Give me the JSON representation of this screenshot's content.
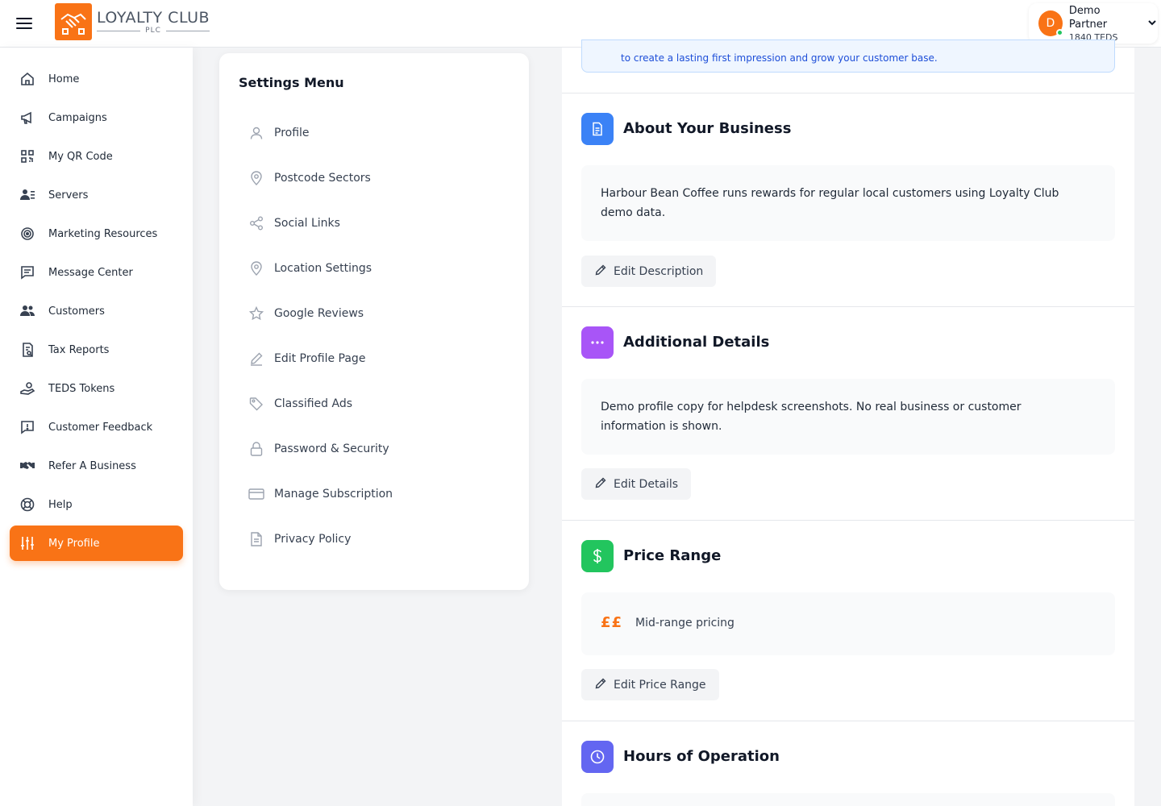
{
  "header": {
    "logo_title": "LOYALTY CLUB",
    "logo_subtitle": "PLC",
    "user_initial": "D",
    "user_name": "Demo Partner",
    "user_tokens": "1840 TEDS"
  },
  "sidebar": {
    "items": [
      {
        "label": "Home",
        "icon": "home-icon"
      },
      {
        "label": "Campaigns",
        "icon": "megaphone-icon"
      },
      {
        "label": "My QR Code",
        "icon": "qr-code-icon"
      },
      {
        "label": "Servers",
        "icon": "servers-icon"
      },
      {
        "label": "Marketing Resources",
        "icon": "target-icon"
      },
      {
        "label": "Message Center",
        "icon": "message-icon"
      },
      {
        "label": "Customers",
        "icon": "users-icon"
      },
      {
        "label": "Tax Reports",
        "icon": "tax-report-icon"
      },
      {
        "label": "TEDS Tokens",
        "icon": "tokens-icon"
      },
      {
        "label": "Customer Feedback",
        "icon": "feedback-icon"
      },
      {
        "label": "Refer A Business",
        "icon": "handshake-icon"
      },
      {
        "label": "Help",
        "icon": "lifebuoy-icon"
      },
      {
        "label": "My Profile",
        "icon": "sliders-icon",
        "active": true
      }
    ]
  },
  "settings_menu": {
    "title": "Settings Menu",
    "items": [
      {
        "label": "Profile",
        "icon": "user-icon"
      },
      {
        "label": "Postcode Sectors",
        "icon": "map-pin-icon"
      },
      {
        "label": "Social Links",
        "icon": "share-icon"
      },
      {
        "label": "Location Settings",
        "icon": "map-pin-icon"
      },
      {
        "label": "Google Reviews",
        "icon": "star-icon"
      },
      {
        "label": "Edit Profile Page",
        "icon": "pencil-icon"
      },
      {
        "label": "Classified Ads",
        "icon": "tag-icon"
      },
      {
        "label": "Password & Security",
        "icon": "lock-icon"
      },
      {
        "label": "Manage Subscription",
        "icon": "credit-card-icon"
      },
      {
        "label": "Privacy Policy",
        "icon": "document-icon"
      }
    ]
  },
  "main": {
    "banner_text": "to create a lasting first impression and grow your customer base.",
    "about": {
      "title": "About Your Business",
      "text": "Harbour Bean Coffee runs rewards for regular local customers using Loyalty Club demo data.",
      "button": "Edit Description",
      "color": "#3b82f6"
    },
    "additional": {
      "title": "Additional Details",
      "text": "Demo profile copy for helpdesk screenshots. No real business or customer information is shown.",
      "button": "Edit Details",
      "color": "#a855f7"
    },
    "price": {
      "title": "Price Range",
      "symbol": "££",
      "text": "Mid-range pricing",
      "button": "Edit Price Range",
      "color": "#22c55e"
    },
    "hours": {
      "title": "Hours of Operation",
      "color": "#6366f1"
    }
  },
  "colors": {
    "accent": "#f97316"
  }
}
